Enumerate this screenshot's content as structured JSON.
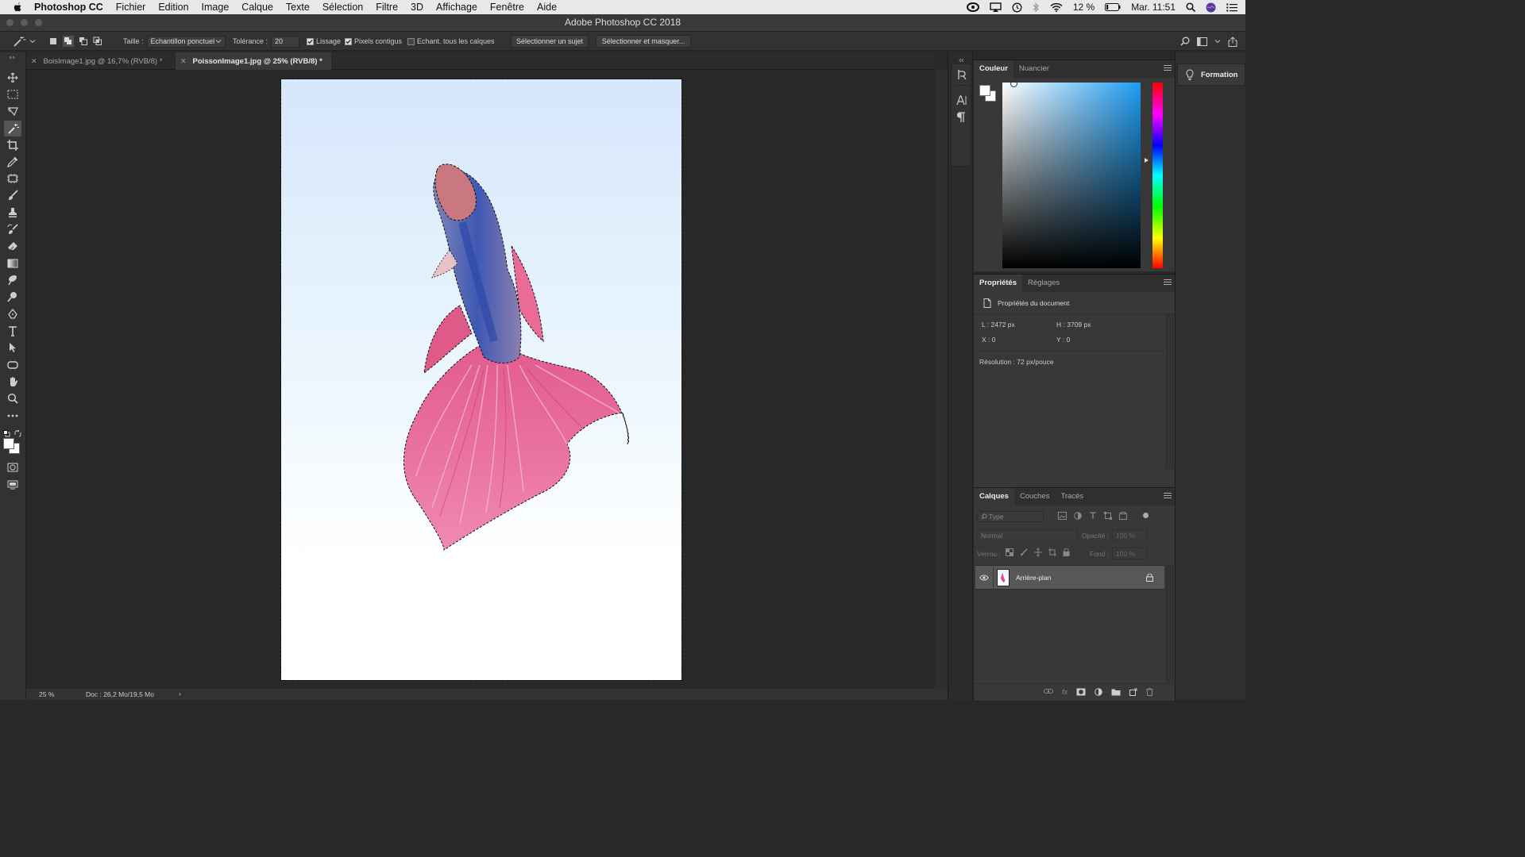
{
  "menubar": {
    "app": "Photoshop CC",
    "items": [
      "Fichier",
      "Edition",
      "Image",
      "Calque",
      "Texte",
      "Sélection",
      "Filtre",
      "3D",
      "Affichage",
      "Fenêtre",
      "Aide"
    ],
    "battery": "12 %",
    "clock": "Mar. 11:51"
  },
  "window": {
    "title": "Adobe Photoshop CC 2018"
  },
  "options": {
    "size_label": "Taille :",
    "size_value": "Echantillon ponctuel",
    "tolerance_label": "Tolérance :",
    "tolerance_value": "20",
    "antialias_label": "Lissage",
    "contiguous_label": "Pixels contigus",
    "sample_all_label": "Echant. tous les calques",
    "select_subject": "Sélectionner un sujet",
    "select_mask": "Sélectionner et masquer..."
  },
  "tabs": [
    {
      "label": "BoisImage1.jpg @ 16,7% (RVB/8) *"
    },
    {
      "label": "PoissonImage1.jpg @ 25% (RVB/8) *"
    }
  ],
  "status": {
    "zoom": "25 %",
    "doc": "Doc : 26,2 Mo/19,5 Mo"
  },
  "learn": {
    "label": "Formation"
  },
  "color_panel": {
    "tabs": [
      "Couleur",
      "Nuancier"
    ],
    "accent": "#1d9cf2"
  },
  "properties_panel": {
    "tabs": [
      "Propriétés",
      "Réglages"
    ],
    "section": "Propriétés du document",
    "w_label": "L :",
    "w_value": "2472 px",
    "h_label": "H :",
    "h_value": "3709 px",
    "x_label": "X :",
    "x_value": "0",
    "y_label": "Y :",
    "y_value": "0",
    "resolution": "Résolution : 72 px/pouce"
  },
  "layers_panel": {
    "tabs": [
      "Calques",
      "Couches",
      "Tracés"
    ],
    "filter_placeholder": "Type",
    "blend_mode": "Normal",
    "opacity_label": "Opacité :",
    "opacity_value": "100 %",
    "lock_label": "Verrou :",
    "fill_label": "Fond :",
    "fill_value": "100 %",
    "layers": [
      {
        "name": "Arrière-plan"
      }
    ]
  }
}
